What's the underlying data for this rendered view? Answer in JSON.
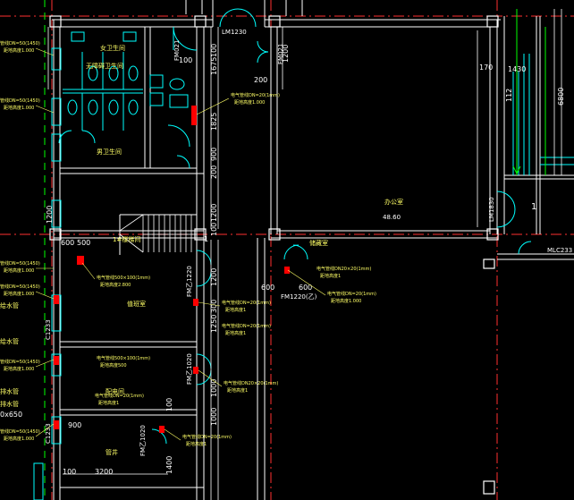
{
  "drawing": {
    "colors": {
      "background": "#000000",
      "wall": "#ffffff",
      "axis": "#ff3030",
      "fixture": "#00ffff",
      "dimension": "#ffffff",
      "label": "#ffff66",
      "pipe": "#00ff00"
    },
    "labels": {
      "lm1230": "LM1230",
      "fm021_a": "FM021",
      "fm021_b": "FM021",
      "lm1830": "LM1830",
      "mlc233": "MLC233",
      "fm1220_c": "FM1220(乙)",
      "fmc_left1": "FM乙1220",
      "fmc_left2": "FM乙1020",
      "fmc_left3": "FM乙1020",
      "c1233_a": "C1233",
      "c1233_b": "C1233",
      "room_big_name": "办公室",
      "room_big_area": "48.60",
      "room_men": "男卫生间",
      "room_women": "女卫生间",
      "room_small_wc": "无障碍卫生间",
      "room_stair": "1#楼梯间",
      "room_storage": "储藏室",
      "room_a": "值班室",
      "room_b": "配电间",
      "room_c": "管井",
      "mark_one": "1",
      "mark_dot": "1"
    },
    "dimensions": {
      "d100_a": "100",
      "d100_b": "100",
      "d1675": "1675",
      "d1825": "1825",
      "d900": "900",
      "d200_a": "200",
      "d200_b": "200",
      "d1200_a": "1200",
      "d1200_b": "1200",
      "d170": "170",
      "d1430": "1430",
      "d112": "112",
      "d6800": "6800",
      "d600_a": "600",
      "d500": "500",
      "d100_c": "100",
      "d1200_c": "1200",
      "d600_b": "600",
      "d600_c": "600",
      "d900_b": "900",
      "d3200": "3200",
      "d100_d": "100",
      "d1400": "1400",
      "d1250": "1250",
      "d1000_a": "1000",
      "d1000_b": "1000",
      "d100_e": "100",
      "d300": "300",
      "d650": "0x650",
      "d100_f": "100",
      "d1200_d": "1200"
    },
    "notes": {
      "n1": "电气管线DN=20(1mm)",
      "n1b": "距地高度1.000",
      "n2": "电气管线DN=20(1mm)",
      "n2b": "距地高度1.000",
      "n3": "电气管线500×100(1mm)",
      "n3b": "距地高度2.800",
      "n4": "电气管线DN=20(1mm)",
      "n4b": "距地高度1",
      "n5": "电气管线DN=20(1mm)",
      "n5b": "距地高度1",
      "n6": "电气管线500×100(1mm)",
      "n6b": "距地高度500",
      "n7": "电气管线DN20×20(1mm)",
      "n7b": "距地高度1",
      "n8": "电气管线DN=20(1mm)",
      "n8b": "距地高度1",
      "n9": "电气管线DN=20(1mm)",
      "n9b": "距地高度1",
      "n10": "电气管线DN20×20(1mm)",
      "n10b": "距地高度1",
      "left1": "管线DN=50(1450)",
      "left1b": "距地高度1.000",
      "left2": "管线DN=50(1450)",
      "left2b": "距地高度1.000",
      "left3": "管线DN=50(1450)",
      "left3b": "距地高度1.000",
      "left4": "管线DN=50(1450)",
      "left4b": "距地高度1.000",
      "left5": "管线DN=50(1450)",
      "left5b": "距地高度1.000",
      "left6": "管线DN=50(1450)",
      "left6b": "距地高度1.000",
      "left_mark1": "给水管",
      "left_mark2": "给水管",
      "left_mark3": "排水管",
      "left_mark4": "排水管"
    }
  }
}
